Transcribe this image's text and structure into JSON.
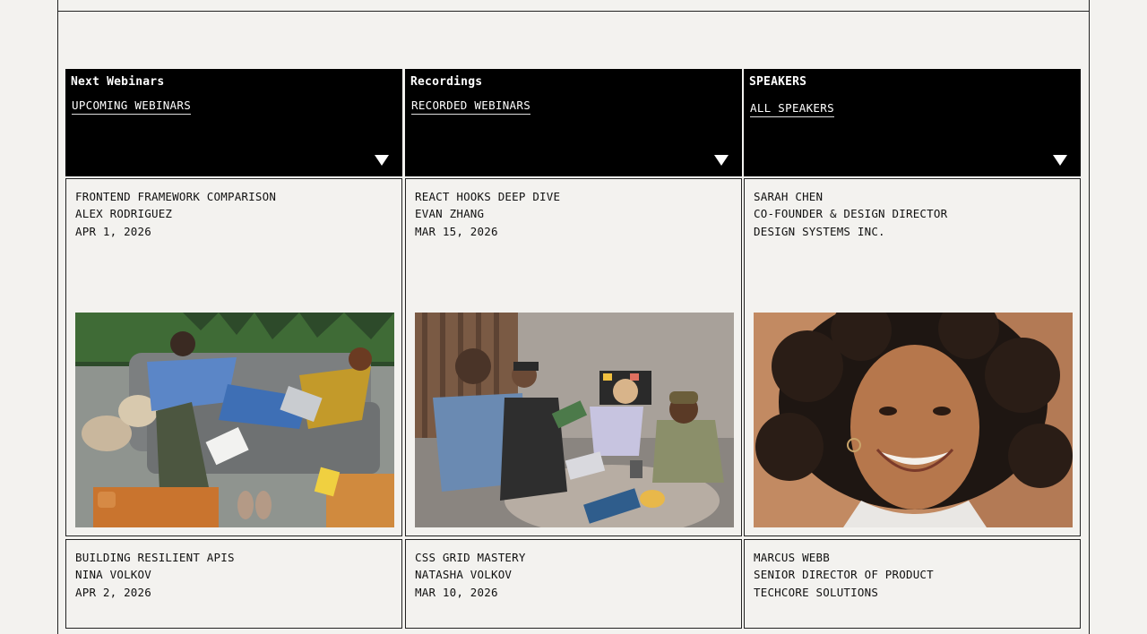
{
  "columns": [
    {
      "header": {
        "title": "Next Webinars",
        "link": "UPCOMING WEBINARS"
      },
      "cards": [
        {
          "line1": "FRONTEND FRAMEWORK COMPARISON",
          "line2": "ALEX RODRIGUEZ",
          "line3": "APR 1, 2026",
          "image": "photo-friends-on-couch-with-laptop"
        },
        {
          "line1": "BUILDING RESILIENT APIS",
          "line2": "NINA VOLKOV",
          "line3": "APR 2, 2026"
        }
      ]
    },
    {
      "header": {
        "title": "Recordings",
        "link": "RECORDED WEBINARS"
      },
      "cards": [
        {
          "line1": "REACT HOOKS DEEP DIVE",
          "line2": "EVAN ZHANG",
          "line3": "MAR 15, 2026",
          "image": "photo-group-study-at-table"
        },
        {
          "line1": "CSS GRID MASTERY",
          "line2": "NATASHA VOLKOV",
          "line3": "MAR 10, 2026"
        }
      ]
    },
    {
      "header": {
        "title": "SPEAKERS",
        "link": "ALL SPEAKERS"
      },
      "cards": [
        {
          "line1": "SARAH CHEN",
          "line2": "CO-FOUNDER & DESIGN DIRECTOR",
          "line3": "DESIGN SYSTEMS INC.",
          "image": "photo-smiling-woman-portrait"
        },
        {
          "line1": "MARCUS WEBB",
          "line2": "SENIOR DIRECTOR OF PRODUCT",
          "line3": "TECHCORE SOLUTIONS"
        }
      ]
    }
  ],
  "icons": {
    "dropdown": "caret-down-icon"
  },
  "colors": {
    "header_bg": "#000000",
    "page_bg": "#f3f2ef",
    "border": "#222222"
  }
}
